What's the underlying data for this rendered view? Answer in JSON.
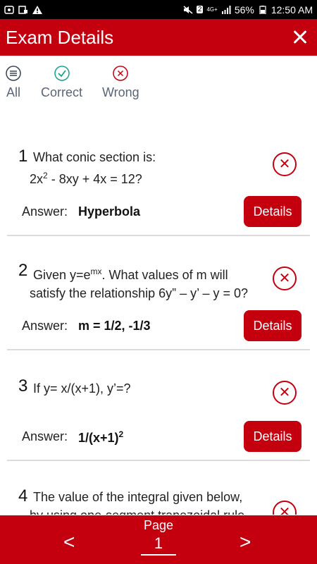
{
  "status_bar": {
    "badge": "2",
    "network": "4G+",
    "battery": "56%",
    "time": "12:50 AM"
  },
  "header": {
    "title": "Exam Details"
  },
  "filters": [
    {
      "label": "All",
      "icon": "list-icon"
    },
    {
      "label": "Correct",
      "icon": "check-circle-icon"
    },
    {
      "label": "Wrong",
      "icon": "x-circle-icon"
    }
  ],
  "questions": [
    {
      "number": "1",
      "line1": "What conic section is:",
      "line2_pre": "2x",
      "line2_sup": "2",
      "line2_post": " - 8xy + 4x = 12?",
      "answer_label": "Answer:",
      "answer": "Hyperbola",
      "details_label": "Details"
    },
    {
      "number": "2",
      "line1_pre": "Given y=e",
      "line1_sup": "mx",
      "line1_post": ". What values of m will",
      "line2": "satisfy the relationship 6y” – y’ – y = 0?",
      "answer_label": "Answer:",
      "answer": "m = 1/2, -1/3",
      "details_label": "Details"
    },
    {
      "number": "3",
      "line1": "If y= x/(x+1), y’=?",
      "answer_label": "Answer:",
      "answer_pre": "1/(x+1)",
      "answer_sup": "2",
      "details_label": "Details"
    },
    {
      "number": "4",
      "line1": "The value of the integral given below,",
      "line2": "by using one-segment trapezoidal rule"
    }
  ],
  "footer": {
    "page_label": "Page",
    "page_number": "1",
    "prev": "<",
    "next": ">"
  },
  "colors": {
    "brand": "#c4000f",
    "correct": "#1aa38a",
    "muted": "#5a6478"
  }
}
